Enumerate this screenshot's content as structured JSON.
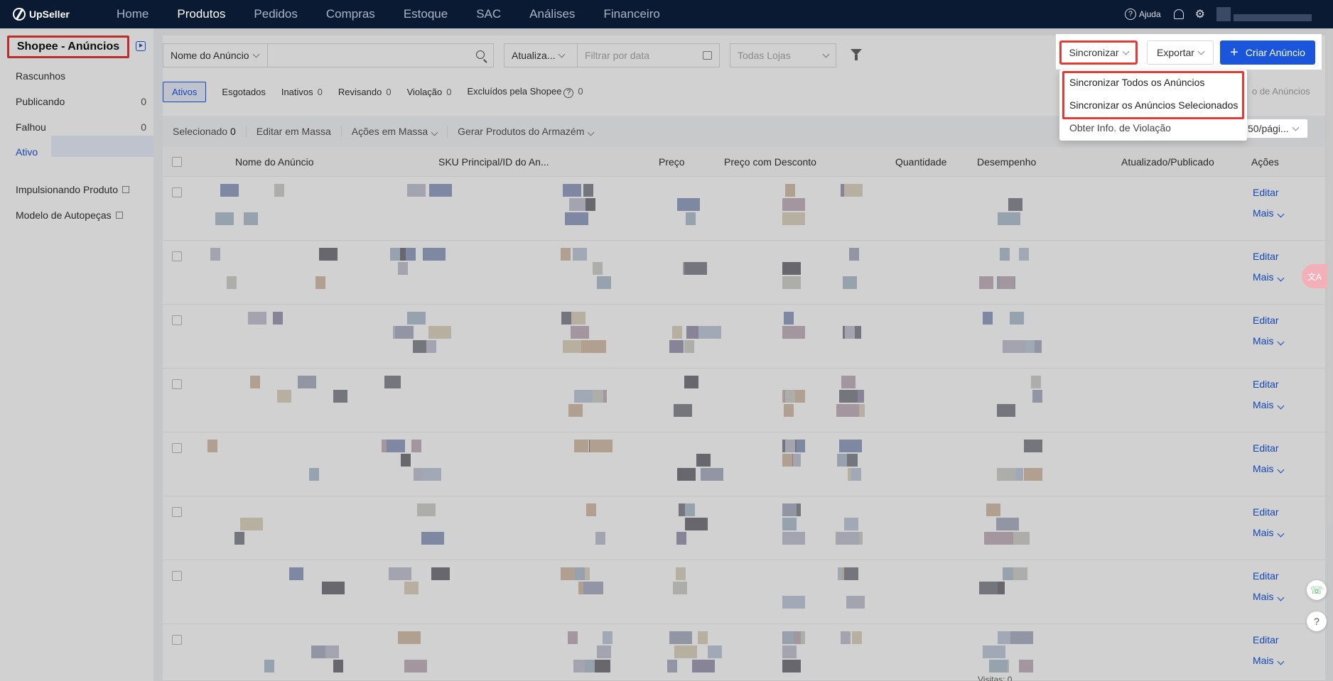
{
  "app": {
    "logo": "UpSeller"
  },
  "topnav": {
    "items": [
      "Home",
      "Produtos",
      "Pedidos",
      "Compras",
      "Estoque",
      "SAC",
      "Análises",
      "Financeiro"
    ],
    "help": "Ajuda"
  },
  "sidebar": {
    "title": "Shopee - Anúncios",
    "items": [
      {
        "label": "Rascunhos",
        "count": ""
      },
      {
        "label": "Publicando",
        "count": "0"
      },
      {
        "label": "Falhou",
        "count": "0"
      },
      {
        "label": "Ativo",
        "count": ""
      }
    ],
    "links": [
      "Impulsionando Produto",
      "Modelo de Autopeças"
    ]
  },
  "filters": {
    "field_select": "Nome do Anúncio",
    "date_select": "Atualiza...",
    "date_placeholder": "Filtrar por data",
    "store_placeholder": "Todas Lojas"
  },
  "status_tabs": [
    {
      "label": "Ativos",
      "count": ""
    },
    {
      "label": "Esgotados",
      "count": ""
    },
    {
      "label": "Inativos",
      "count": "0"
    },
    {
      "label": "Revisando",
      "count": "0"
    },
    {
      "label": "Violação",
      "count": "0"
    },
    {
      "label": "Excluídos pela Shopee",
      "count": "0"
    }
  ],
  "bulkbar": {
    "selected_label": "Selecionado",
    "selected_count": "0",
    "edit_mass": "Editar em Massa",
    "actions_mass": "Ações em Massa",
    "generate": "Gerar Produtos do Armazém"
  },
  "table": {
    "columns": [
      "Nome do Anúncio",
      "SKU Principal/ID do An...",
      "Preço",
      "Preço com Desconto",
      "Quantidade",
      "Desempenho",
      "Atualizado/Publicado",
      "Ações"
    ],
    "row_actions": {
      "edit": "Editar",
      "more": "Mais"
    },
    "footer_visits": "Visitas: 0"
  },
  "toolbar": {
    "sync": "Sincronizar",
    "export": "Exportar",
    "create": "Criar Anúncio",
    "partial_right": "o de Anúncios",
    "pager": "50/pági..."
  },
  "sync_dropdown": {
    "items": [
      "Sincronizar Todos os Anúncios",
      "Sincronizar os Anúncios Selecionados",
      "Obter Info. de Violação"
    ]
  }
}
